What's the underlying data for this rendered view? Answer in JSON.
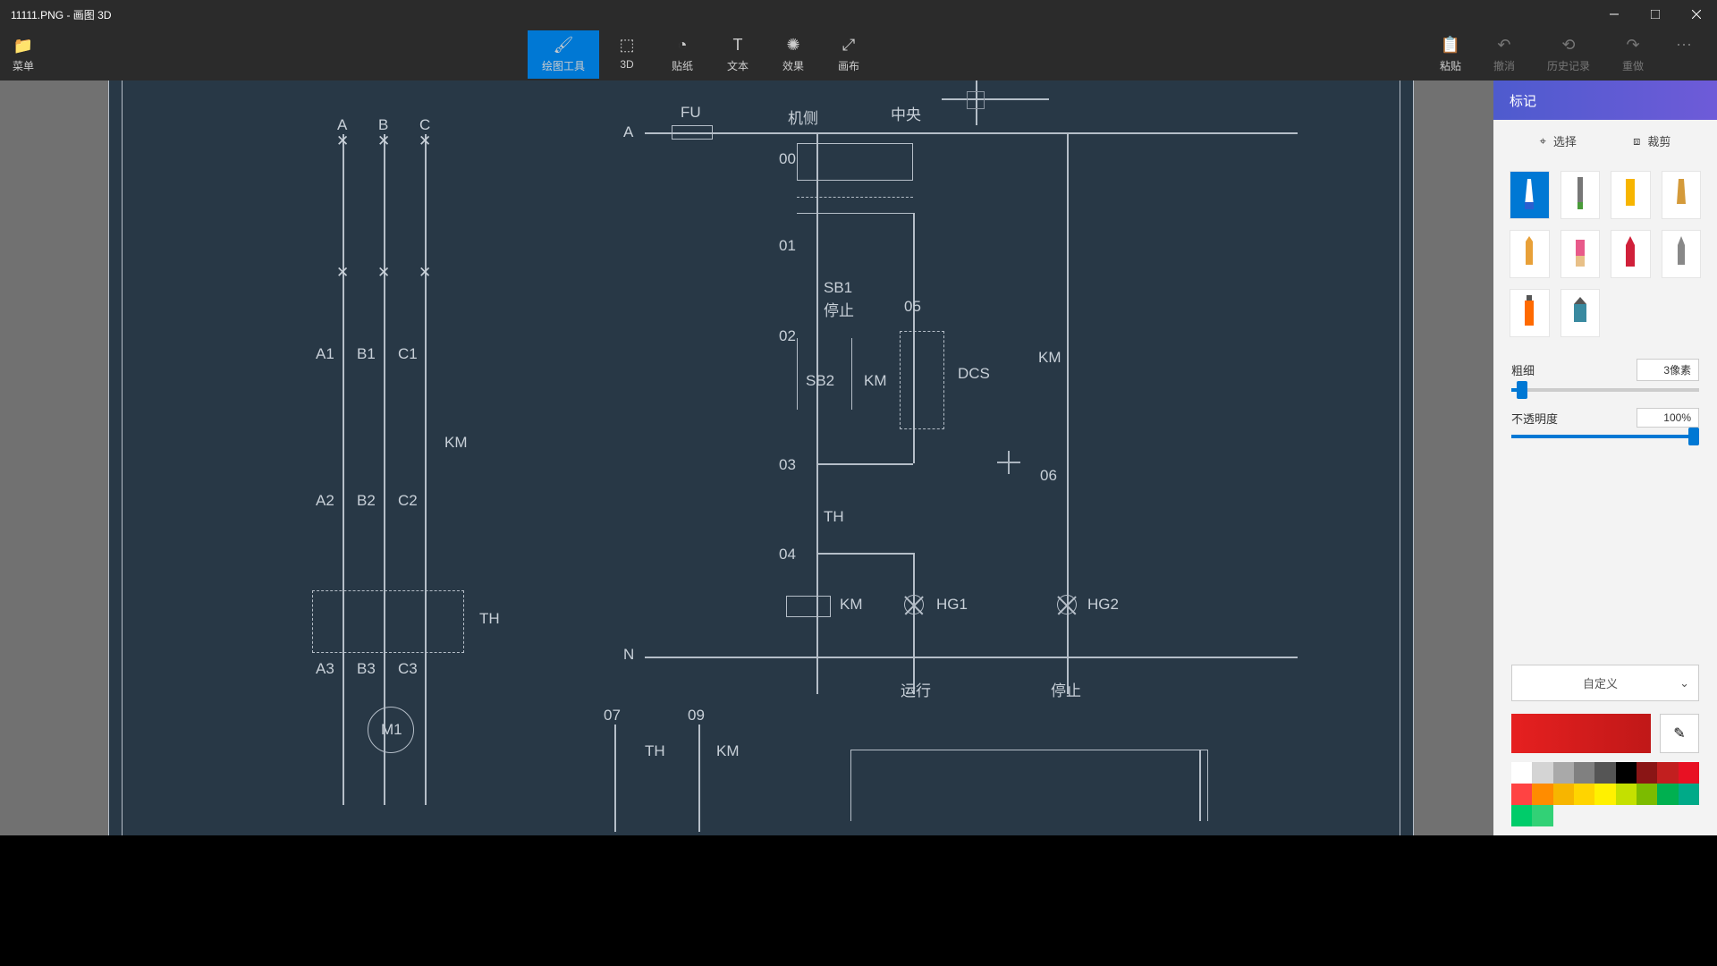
{
  "window": {
    "title": "11111.PNG - 画图 3D"
  },
  "menu": {
    "label": "菜单"
  },
  "tabs": {
    "brush": "绘图工具",
    "3d": "3D",
    "stickers": "贴纸",
    "text": "文本",
    "effects": "效果",
    "canvas": "画布"
  },
  "rightTools": {
    "paste": "粘贴",
    "undo": "撤消",
    "history": "历史记录",
    "redo": "重做"
  },
  "panel": {
    "title": "标记",
    "select": "选择",
    "crop": "裁剪",
    "thickness_label": "粗细",
    "thickness_value": "3像素",
    "opacity_label": "不透明度",
    "opacity_value": "100%",
    "custom": "自定义"
  },
  "palette": {
    "row1": [
      "#ffffff",
      "#d4d4d4",
      "#a9a9a9",
      "#808080",
      "#555555",
      "#000000",
      "#8a1515",
      "#c21f1f",
      "#e81123",
      "#ff4343"
    ],
    "row2": [
      "#ff8c00",
      "#f7b500",
      "#ffd400",
      "#fff100",
      "#c4e000",
      "#7cbb00",
      "#00b050",
      "#00aa88",
      "#00cc6a",
      "#32d176"
    ]
  },
  "cad": {
    "phase": {
      "A": "A",
      "B": "B",
      "C": "C",
      "busA": "A",
      "busN": "N"
    },
    "FU": "FU",
    "machine_side": "机侧",
    "center": "中央",
    "rows": {
      "A1": "A1",
      "B1": "B1",
      "C1": "C1",
      "A2": "A2",
      "B2": "B2",
      "C2": "C2",
      "A3": "A3",
      "B3": "B3",
      "C3": "C3"
    },
    "KM": "KM",
    "TH": "TH",
    "M1": "M1",
    "nodes": {
      "n00": "00",
      "n01": "01",
      "n02": "02",
      "n03": "03",
      "n04": "04",
      "n05": "05",
      "n06": "06",
      "n07": "07",
      "n09": "09"
    },
    "SB1": "SB1",
    "stop": "停止",
    "SB2": "SB2",
    "DCS": "DCS",
    "HG1": "HG1",
    "HG2": "HG2",
    "run": "运行",
    "stop2": "停止"
  }
}
